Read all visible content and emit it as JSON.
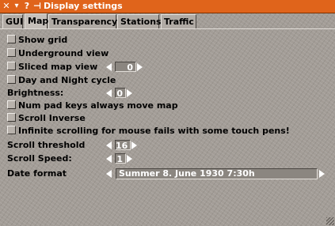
{
  "window": {
    "title": "Display settings"
  },
  "titlebar": {
    "close_glyph": "✕",
    "menu_glyph": "▾",
    "help_glyph": "?",
    "pin_glyph": "⊣"
  },
  "tabs": [
    {
      "label": "GUI",
      "active": false
    },
    {
      "label": "Map",
      "active": true
    },
    {
      "label": "Transparency",
      "active": false
    },
    {
      "label": "Stations",
      "active": false
    },
    {
      "label": "Traffic",
      "active": false
    }
  ],
  "options": {
    "show_grid": "Show grid",
    "underground_view": "Underground view",
    "sliced_map_view": "Sliced map view",
    "sliced_value": "0",
    "day_night": "Day and Night cycle",
    "brightness_label": "Brightness:",
    "brightness_value": "0",
    "numpad": "Num pad keys always move map",
    "scroll_inverse": "Scroll Inverse",
    "infinite_scroll": "Infinite scrolling for mouse fails with some touch pens!",
    "scroll_threshold_label": "Scroll threshold",
    "scroll_threshold_value": "16",
    "scroll_speed_label": "Scroll Speed:",
    "scroll_speed_value": "1",
    "date_format_label": "Date format",
    "date_format_value": "Summer 8. June 1930  7:30h"
  },
  "colors": {
    "titlebar": "#e0641b",
    "text": "#000000",
    "field_text": "#ffffff"
  }
}
